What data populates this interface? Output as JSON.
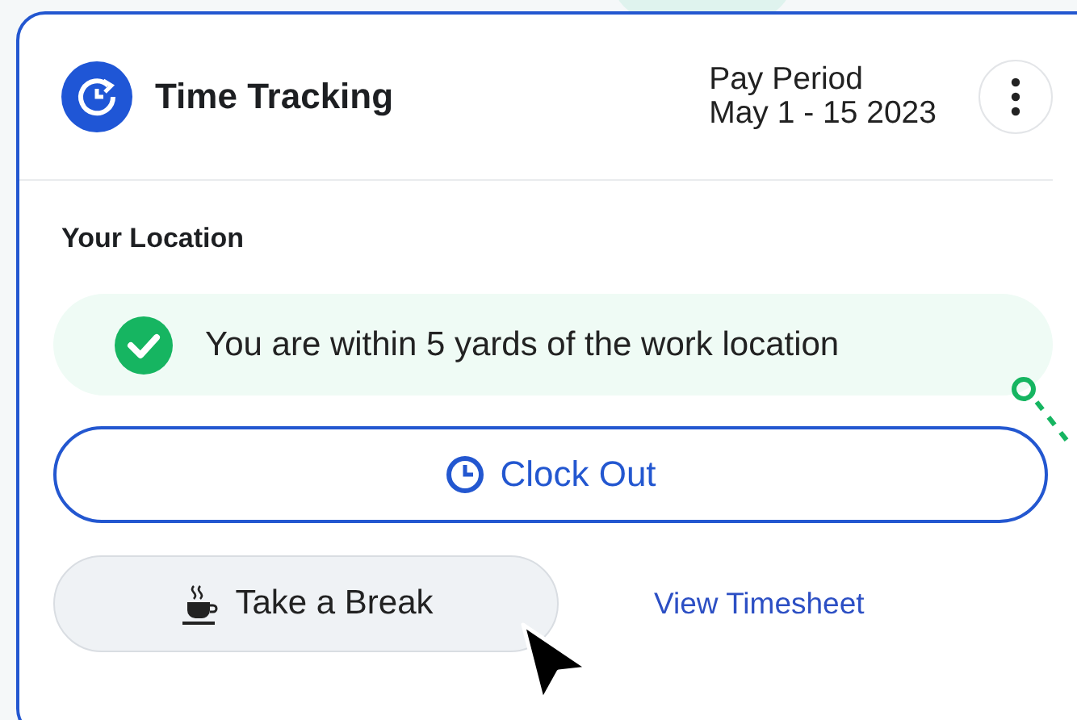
{
  "header": {
    "title": "Time Tracking",
    "pay_period_label": "Pay Period",
    "pay_period_value": "May 1 - 15 2023"
  },
  "location": {
    "heading": "Your Location",
    "status": "You are within 5 yards of the work location"
  },
  "clock_out_button": "Clock Out",
  "break_button": "Take a Break",
  "timesheet_link": "View Timesheet"
}
